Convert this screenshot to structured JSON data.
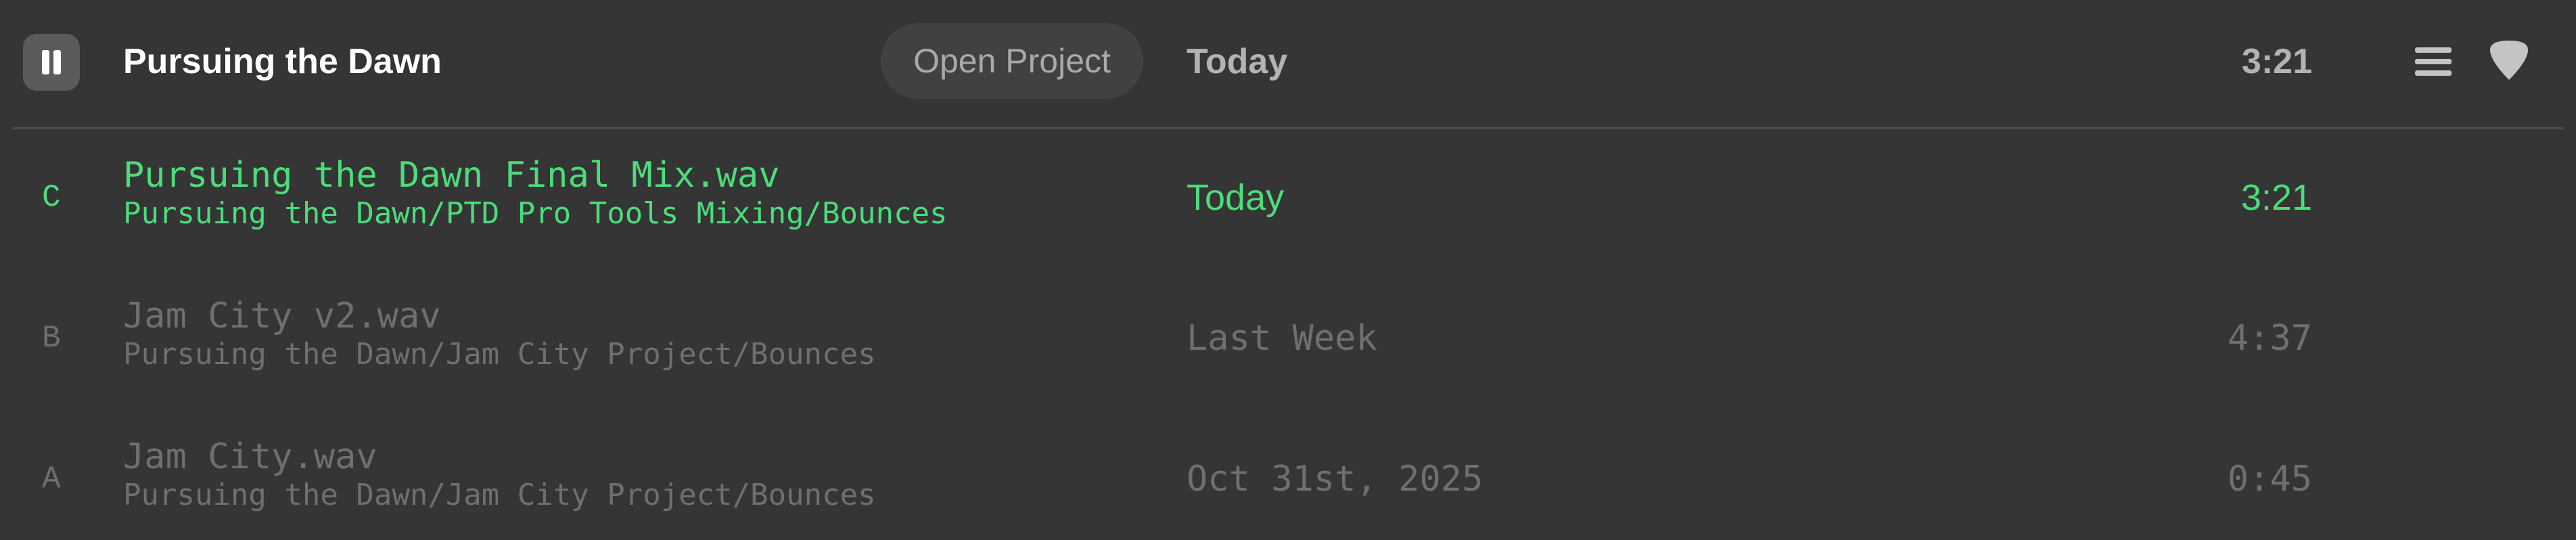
{
  "header": {
    "play_state": "pause-icon",
    "title": "Pursuing the Dawn",
    "open_project_label": "Open Project",
    "date": "Today",
    "duration": "3:21",
    "icons": [
      "list-icon",
      "guitar-pick-icon"
    ]
  },
  "colors": {
    "background": "#353535",
    "active": "#4cdc7a",
    "inactive": "#6f6f6f",
    "header_text": "#b3b3b3",
    "title": "#ffffff"
  },
  "rows": [
    {
      "letter": "C",
      "file_name": "Pursuing the Dawn Final Mix.wav",
      "path": "Pursuing the Dawn/PTD Pro Tools Mixing/Bounces",
      "date": "Today",
      "duration": "3:21",
      "active": true
    },
    {
      "letter": "B",
      "file_name": "Jam City v2.wav",
      "path": "Pursuing the Dawn/Jam City Project/Bounces",
      "date": "Last Week",
      "duration": "4:37",
      "active": false
    },
    {
      "letter": "A",
      "file_name": "Jam City.wav",
      "path": "Pursuing the Dawn/Jam City Project/Bounces",
      "date": "Oct 31st, 2025",
      "duration": "0:45",
      "active": false
    }
  ]
}
